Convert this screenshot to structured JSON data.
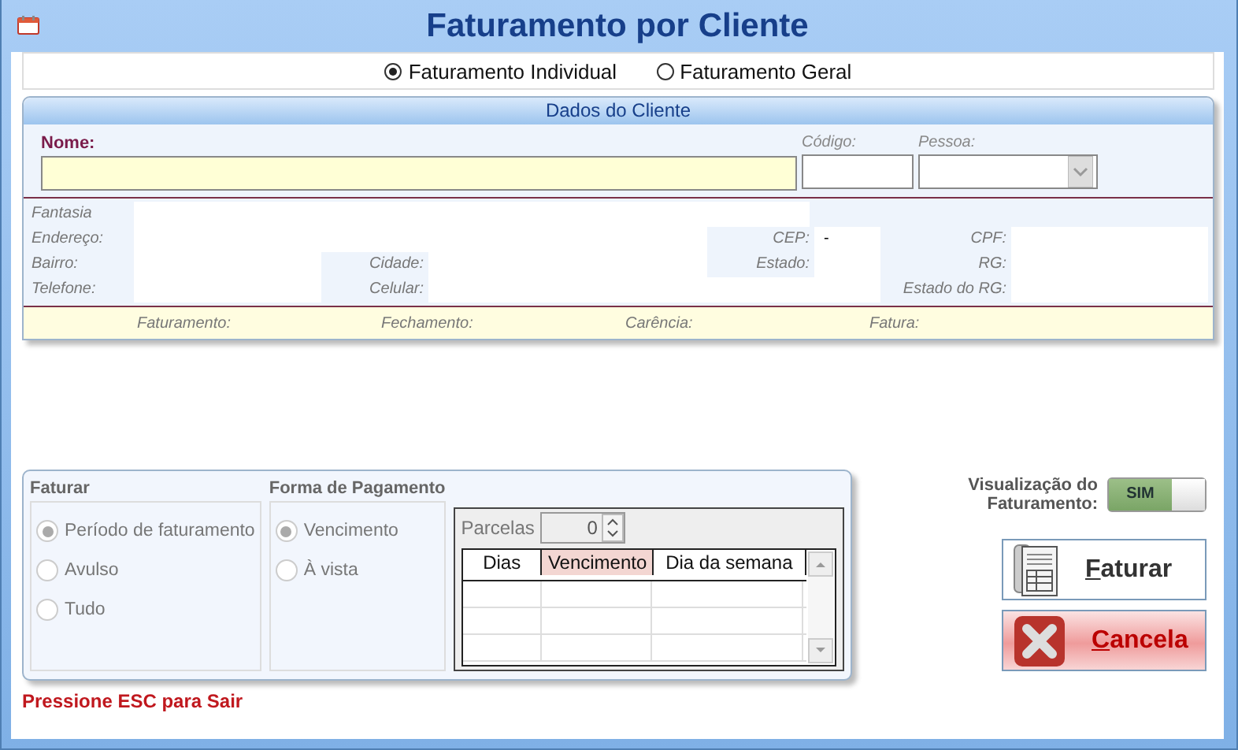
{
  "window": {
    "title": "Faturamento por Cliente"
  },
  "mode_options": [
    {
      "label": "Faturamento Individual",
      "selected": true
    },
    {
      "label": "Faturamento Geral",
      "selected": false
    }
  ],
  "client_panel": {
    "title": "Dados do Cliente",
    "fields": [
      {
        "label": "Nome:",
        "kind": "text"
      },
      {
        "label": "Código:",
        "kind": "text"
      },
      {
        "label": "Pessoa:",
        "kind": "select"
      }
    ],
    "info_rows": [
      [
        {
          "label": "Fantasia"
        }
      ],
      [
        {
          "label": "Endereço:"
        },
        {
          "label": "CEP:",
          "value": "-"
        },
        {
          "label": "CPF:"
        }
      ],
      [
        {
          "label": "Bairro:"
        },
        {
          "label": "Cidade:"
        },
        {
          "label": "Estado:"
        },
        {
          "label": "RG:"
        }
      ],
      [
        {
          "label": "Telefone:"
        },
        {
          "label": "Celular:"
        },
        {
          "label": "Estado do RG:"
        }
      ]
    ],
    "billing_labels": [
      "Faturamento:",
      "Fechamento:",
      "Carência:",
      "Fatura:"
    ]
  },
  "faturar": {
    "title": "Faturar",
    "disabled": true,
    "options": [
      {
        "label": "Período de faturamento",
        "selected": true
      },
      {
        "label": "Avulso",
        "selected": false
      },
      {
        "label": "Tudo",
        "selected": false
      }
    ]
  },
  "pagamento": {
    "title": "Forma de Pagamento",
    "disabled": true,
    "options": [
      {
        "label": "Vencimento",
        "selected": true
      },
      {
        "label": "À vista",
        "selected": false
      }
    ],
    "parcelas": {
      "label": "Parcelas",
      "value": "0"
    },
    "columns": [
      {
        "label": "Dias",
        "highlighted": false
      },
      {
        "label": "Vencimento",
        "highlighted": true
      },
      {
        "label": "Dia da semana",
        "highlighted": false
      }
    ]
  },
  "visualizacao": {
    "label": "Visualização do Faturamento:",
    "toggle": "SIM",
    "on": true
  },
  "buttons": [
    {
      "label": "Faturar",
      "kind": "invoice"
    },
    {
      "label": "Cancela",
      "kind": "cancel"
    }
  ],
  "footer": "Pressione ESC para Sair"
}
